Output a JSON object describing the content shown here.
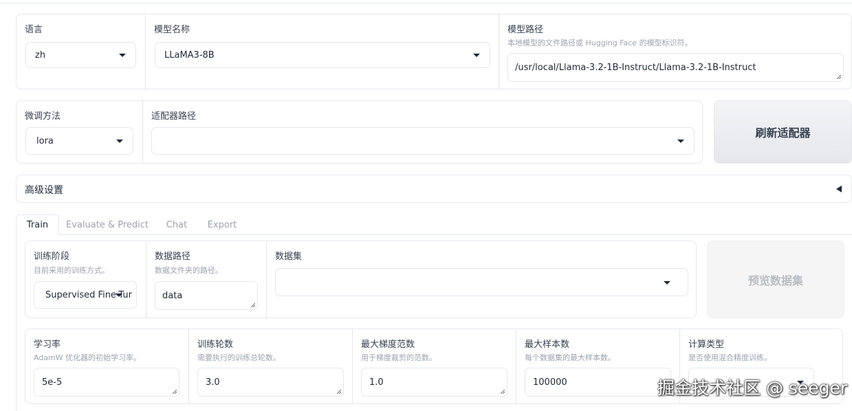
{
  "language": {
    "label": "语言",
    "value": "zh"
  },
  "model_name": {
    "label": "模型名称",
    "value": "LLaMA3-8B"
  },
  "model_path": {
    "label": "模型路径",
    "hint": "本地模型的文件路径或 Hugging Face 的模型标识符。",
    "value": "/usr/local/Llama-3.2-1B-Instruct/Llama-3.2-1B-Instruct"
  },
  "finetune_method": {
    "label": "微调方法",
    "value": "lora"
  },
  "adapter_path": {
    "label": "适配器路径",
    "value": ""
  },
  "refresh_button": "刷新适配器",
  "advanced": {
    "title": "高级设置"
  },
  "tabs": [
    "Train",
    "Evaluate & Predict",
    "Chat",
    "Export"
  ],
  "train": {
    "stage": {
      "label": "训练阶段",
      "hint": "目前采用的训练方式。",
      "value": "Supervised Fine-Tur"
    },
    "dataset_dir": {
      "label": "数据路径",
      "hint": "数据文件夹的路径。",
      "value": "data"
    },
    "dataset": {
      "label": "数据集",
      "value": ""
    },
    "preview_button": "预览数据集",
    "learning_rate": {
      "label": "学习率",
      "hint": "AdamW 优化器的初始学习率。",
      "value": "5e-5"
    },
    "epochs": {
      "label": "训练轮数",
      "hint": "需要执行的训练总轮数。",
      "value": "3.0"
    },
    "max_grad_norm": {
      "label": "最大梯度范数",
      "hint": "用于梯度裁剪的范数。",
      "value": "1.0"
    },
    "max_samples": {
      "label": "最大样本数",
      "hint": "每个数据集的最大样本数。",
      "value": "100000"
    },
    "compute_type": {
      "label": "计算类型",
      "hint": "是否使用混合精度训练。",
      "value": ""
    }
  },
  "watermark": "掘金技术社区 @ seeger"
}
